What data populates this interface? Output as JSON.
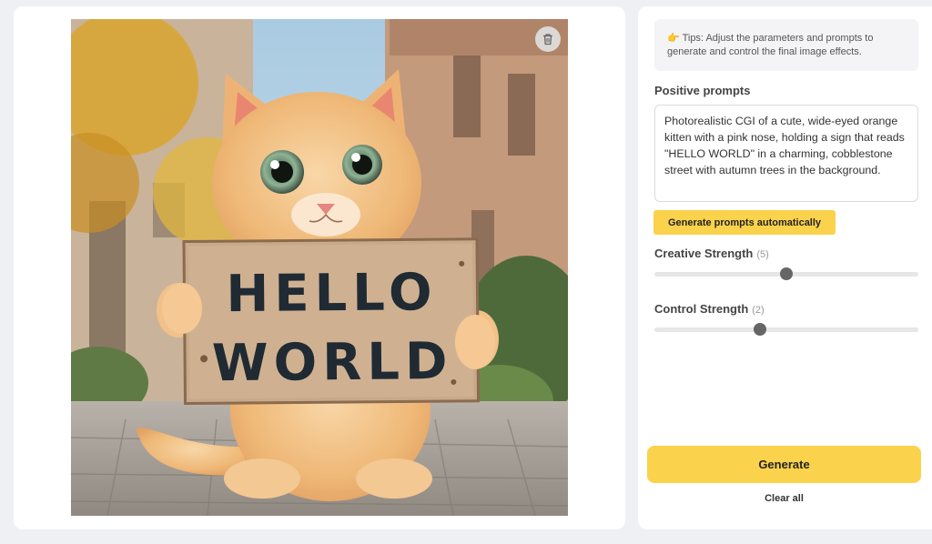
{
  "preview": {
    "image_description_icon": "kitten-holding-sign-image",
    "sign_line_1": "HELLO",
    "sign_line_2": "WORLD",
    "delete_icon": "trash-icon"
  },
  "tips": {
    "icon": "pointing-hand-emoji",
    "emoji": "👉",
    "text": "Tips: Adjust the parameters and prompts to generate and control the final image effects."
  },
  "positive_prompts": {
    "label": "Positive prompts",
    "value": "Photorealistic CGI of a cute, wide-eyed orange kitten with a pink nose, holding a sign that reads \"HELLO WORLD\" in a charming, cobblestone street with autumn trees in the background.",
    "auto_button_label": "Generate prompts automatically"
  },
  "creative_strength": {
    "label": "Creative Strength",
    "value_display": "(5)",
    "value": 5,
    "min": 0,
    "max": 10
  },
  "control_strength": {
    "label": "Control Strength",
    "value_display": "(2)",
    "value": 2,
    "min": -2,
    "max": 8
  },
  "actions": {
    "generate_label": "Generate",
    "clear_label": "Clear all"
  },
  "colors": {
    "accent": "#fbd24b",
    "page_bg": "#eef0f4",
    "thumb": "#666666"
  }
}
